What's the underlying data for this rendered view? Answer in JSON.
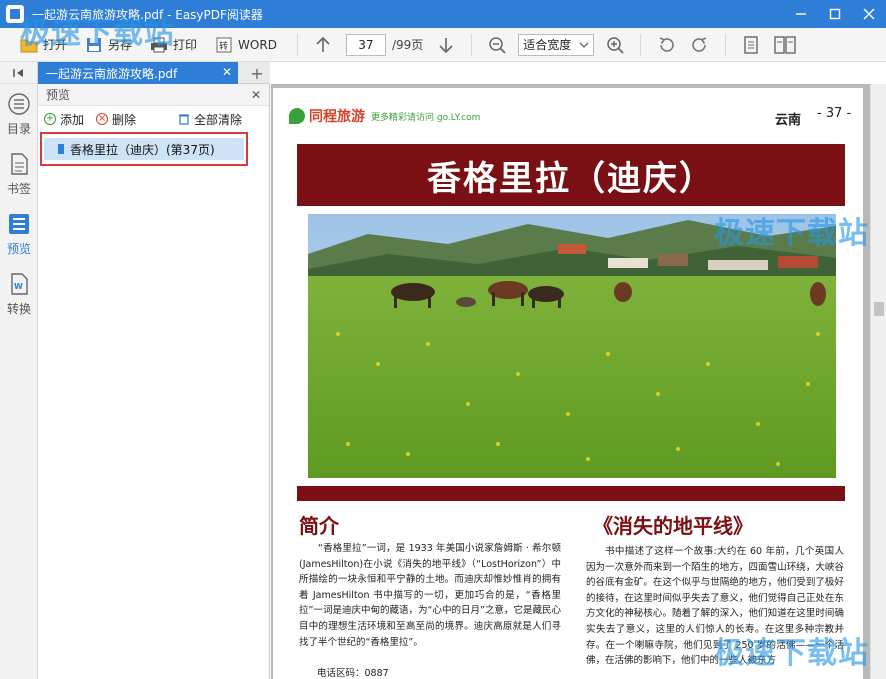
{
  "window": {
    "title": "一起游云南旅游攻略.pdf - EasyPDF阅读器",
    "controls": [
      "minimize-icon",
      "maximize-icon",
      "close-icon"
    ]
  },
  "toolbar": {
    "open_label": "打开",
    "save_as_label": "另存",
    "print_label": "打印",
    "word_label": "WORD",
    "current_page": "37",
    "total_pages": "/99页",
    "zoom_mode": "适合宽度"
  },
  "rail": {
    "items": [
      {
        "label": "目录",
        "icon": "list-icon"
      },
      {
        "label": "书签",
        "icon": "document-icon"
      },
      {
        "label": "预览",
        "icon": "preview-icon"
      },
      {
        "label": "转换",
        "icon": "convert-icon"
      }
    ]
  },
  "tabs": {
    "doc_tab_label": "一起游云南旅游攻略.pdf",
    "add_tab": "+"
  },
  "panel": {
    "title": "预览",
    "add_label": "添加",
    "delete_label": "删除",
    "clear_all_label": "全部清除",
    "bookmark_item": "香格里拉（迪庆）(第37页)"
  },
  "page": {
    "brand": "同程旅游",
    "slogan": "更多精彩请访问 go.LY.com",
    "region": "云南",
    "page_number": "- 37 -",
    "banner_title": "香格里拉（迪庆）",
    "left_heading": "简介",
    "left_text": "“香格里拉”一词，是 1933 年美国小说家詹姆斯 · 希尔顿(JamesHilton)在小说《消失的地平线》（“LostHorizon”）中所描绘的一块永恒和平宁静的土地。而迪庆却惟妙惟肖的拥有着 JamesHilton 书中描写的一切，更加巧合的是，“香格里拉”一词是迪庆中甸的藏语，为“心中的日月”之意，它是藏民心目中的理想生活环境和至高至尚的境界。迪庆高原就是人们寻找了半个世纪的“香格里拉”。",
    "phone": "电话区码：0887",
    "right_heading": "《消失的地平线》",
    "right_text": "书中描述了这样一个故事:大约在 60 年前，几个英国人因为一次意外而来到一个陌生的地方，四面雪山环绕，大峡谷的谷底有金矿。在这个似乎与世隔绝的地方，他们受到了极好的接待，在这里时间似乎失去了意义，他们觉得自己正处在东方文化的神秘核心。随着了解的深入，他们知道在这里时间确实失去了意义，这里的人们惊人的长寿。在这里多种宗教并存。在一个喇嘛寺院，他们见到了 250 岁的活佛——一个活佛，在活佛的影响下，他们中的一些人被东方"
  },
  "watermark": "极速下载站",
  "colors": {
    "accent": "#2e7dd6",
    "banner": "#7a0f14",
    "highlight_border": "#d93b3b"
  }
}
